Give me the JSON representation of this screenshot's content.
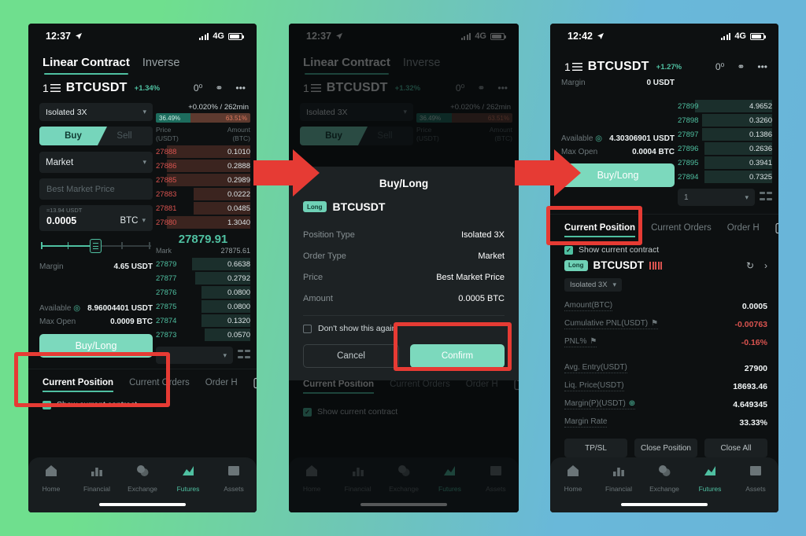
{
  "background": {
    "left_color": "#6fdf8e",
    "right_color": "#69b4d9"
  },
  "accent": {
    "teal": "#4fc0a1",
    "button": "#7cd9bd",
    "red": "#d9534f",
    "annotation": "#e63b34"
  },
  "phone1": {
    "status": {
      "time": "12:37",
      "network": "4G"
    },
    "contract_tabs": [
      {
        "label": "Linear Contract",
        "active": true
      },
      {
        "label": "Inverse",
        "active": false
      }
    ],
    "symbol": {
      "name": "BTCUSDT",
      "change": "+1.34%",
      "leverage_icon": "1"
    },
    "order_form": {
      "position_type": "Isolated  3X",
      "side_buy": "Buy",
      "side_sell": "Sell",
      "order_type": "Market",
      "price_placeholder": "Best Market Price",
      "amount_hint": "≈13.94 USDT",
      "amount_value": "0.0005",
      "amount_unit": "BTC",
      "margin_label": "Margin",
      "margin_value": "4.65 USDT",
      "available_label": "Available",
      "available_value": "8.96004401 USDT",
      "max_open_label": "Max Open",
      "max_open_value": "0.0009 BTC",
      "cta": "Buy/Long"
    },
    "orderbook": {
      "funding": "+0.020% / 262min",
      "long_ratio": "36.49%",
      "short_ratio": "63.51%",
      "head_price": "Price\n(USDT)",
      "head_price_l1": "Price",
      "head_price_l2": "(USDT)",
      "head_amount_l1": "Amount",
      "head_amount_l2": "(BTC)",
      "asks": [
        {
          "price": "27888",
          "qty": "0.1010",
          "depth": 88
        },
        {
          "price": "27886",
          "qty": "0.2888",
          "depth": 88
        },
        {
          "price": "27885",
          "qty": "0.2989",
          "depth": 88
        },
        {
          "price": "27883",
          "qty": "0.0222",
          "depth": 60
        },
        {
          "price": "27881",
          "qty": "0.0485",
          "depth": 60
        },
        {
          "price": "27880",
          "qty": "1.3040",
          "depth": 88
        }
      ],
      "last_price": "27879.91",
      "mark_label": "Mark",
      "mark_value": "27875.61",
      "bids": [
        {
          "price": "27879",
          "qty": "0.6638",
          "depth": 62
        },
        {
          "price": "27877",
          "qty": "0.2792",
          "depth": 58
        },
        {
          "price": "27876",
          "qty": "0.0800",
          "depth": 52
        },
        {
          "price": "27875",
          "qty": "0.0800",
          "depth": 52
        },
        {
          "price": "27874",
          "qty": "0.1320",
          "depth": 52
        },
        {
          "price": "27873",
          "qty": "0.0570",
          "depth": 48
        }
      ],
      "group_value": ""
    },
    "position_tabs": [
      {
        "label": "Current Position",
        "active": true
      },
      {
        "label": "Current Orders",
        "active": false
      },
      {
        "label": "Order H",
        "active": false
      }
    ],
    "show_current_contract": "Show current contract",
    "nav": [
      {
        "label": "Home",
        "active": false
      },
      {
        "label": "Financial",
        "active": false
      },
      {
        "label": "Exchange",
        "active": false
      },
      {
        "label": "Futures",
        "active": true
      },
      {
        "label": "Assets",
        "active": false
      }
    ]
  },
  "phone2": {
    "status": {
      "time": "12:37",
      "network": "4G"
    },
    "contract_tabs": [
      {
        "label": "Linear Contract",
        "active": true
      },
      {
        "label": "Inverse",
        "active": false
      }
    ],
    "symbol": {
      "name": "BTCUSDT",
      "change": "+1.32%",
      "leverage_icon": "1"
    },
    "order_form": {
      "position_type": "Isolated  3X",
      "side_buy": "Buy",
      "side_sell": "Sell",
      "cta": "Buy/Long"
    },
    "orderbook": {
      "funding": "+0.020% / 262min",
      "long_ratio": "36.49%",
      "short_ratio": "63.51%",
      "head_price_l1": "Price",
      "head_price_l2": "(USDT)",
      "head_amount_l1": "Amount",
      "head_amount_l2": "(BTC)"
    },
    "modal": {
      "title": "Buy/Long",
      "badge": "Long",
      "symbol": "BTCUSDT",
      "rows": [
        {
          "key": "Position Type",
          "value": "Isolated  3X"
        },
        {
          "key": "Order Type",
          "value": "Market"
        },
        {
          "key": "Price",
          "value": "Best Market Price"
        },
        {
          "key": "Amount",
          "value": "0.0005 BTC"
        }
      ],
      "dont_show": "Don't show this again",
      "cancel": "Cancel",
      "confirm": "Confirm"
    },
    "position_tabs": [
      {
        "label": "Current Position",
        "active": true
      },
      {
        "label": "Current Orders",
        "active": false
      },
      {
        "label": "Order H",
        "active": false
      }
    ],
    "show_current_contract": "Show current contract",
    "nav": [
      {
        "label": "Home",
        "active": false
      },
      {
        "label": "Financial",
        "active": false
      },
      {
        "label": "Exchange",
        "active": false
      },
      {
        "label": "Futures",
        "active": true
      },
      {
        "label": "Assets",
        "active": false
      }
    ]
  },
  "phone3": {
    "status": {
      "time": "12:42",
      "network": "4G"
    },
    "symbol": {
      "name": "BTCUSDT",
      "change": "+1.27%",
      "leverage_icon": "1"
    },
    "summary": {
      "margin_label": "Margin",
      "margin_value": "0 USDT",
      "available_label": "Available",
      "available_value": "4.30306901 USDT",
      "max_open_label": "Max Open",
      "max_open_value": "0.0004 BTC",
      "cta": "Buy/Long"
    },
    "orderbook": {
      "bids": [
        {
          "price": "27899",
          "qty": "4.9652",
          "depth": 82
        },
        {
          "price": "27898",
          "qty": "0.3260",
          "depth": 74
        },
        {
          "price": "27897",
          "qty": "0.1386",
          "depth": 74
        },
        {
          "price": "27896",
          "qty": "0.2636",
          "depth": 72
        },
        {
          "price": "27895",
          "qty": "0.3941",
          "depth": 72
        },
        {
          "price": "27894",
          "qty": "0.7325",
          "depth": 72
        }
      ],
      "group_value": "1"
    },
    "position_tabs": [
      {
        "label": "Current Position",
        "active": true
      },
      {
        "label": "Current Orders",
        "active": false
      },
      {
        "label": "Order H",
        "active": false
      }
    ],
    "show_current_contract": "Show current contract",
    "position_card": {
      "badge": "Long",
      "symbol": "BTCUSDT",
      "leverage": "Isolated 3X",
      "rows": [
        {
          "key": "Amount(BTC)",
          "value": "0.0005",
          "negative": false
        },
        {
          "key": "Cumulative PNL(USDT)",
          "value": "-0.00763",
          "negative": true,
          "flag": true
        },
        {
          "key": "PNL%",
          "value": "-0.16%",
          "negative": true,
          "flag": true
        }
      ],
      "rows2": [
        {
          "key": "Avg. Entry(USDT)",
          "value": "27900",
          "negative": false
        },
        {
          "key": "Liq. Price(USDT)",
          "value": "18693.46",
          "negative": false
        },
        {
          "key": "Margin(P)(USDT)",
          "value": "4.649345",
          "negative": false,
          "plus": true
        },
        {
          "key": "Margin Rate",
          "value": "33.33%",
          "negative": false
        }
      ],
      "buttons": [
        "TP/SL",
        "Close Position",
        "Close All"
      ]
    },
    "nav": [
      {
        "label": "Home",
        "active": false
      },
      {
        "label": "Financial",
        "active": false
      },
      {
        "label": "Exchange",
        "active": false
      },
      {
        "label": "Futures",
        "active": true
      },
      {
        "label": "Assets",
        "active": false
      }
    ]
  },
  "annotations": {
    "highlight_1": "buy-long-button-phone1",
    "highlight_2": "confirm-button-phone2",
    "highlight_3": "current-position-tab-phone3",
    "arrow_1": "arrow-phone1-to-phone2",
    "arrow_2": "arrow-phone2-to-phone3"
  }
}
